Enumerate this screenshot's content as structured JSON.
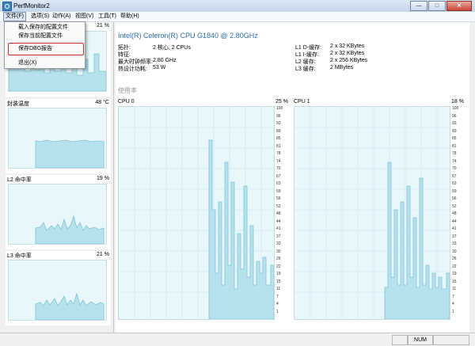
{
  "window": {
    "title": "PerfMonitor2",
    "min": "—",
    "max": "□",
    "close": "✕"
  },
  "menu": [
    "文件(F)",
    "选项(S)",
    "动作(A)",
    "视图(V)",
    "工具(T)",
    "帮助(H)"
  ],
  "file_menu": [
    "载入保存的配置文件",
    "保存当前配置文件",
    "保存DBG报告",
    "退出(X)"
  ],
  "left_panels": [
    {
      "title": "",
      "value": "21 %"
    },
    {
      "title": "封装温度",
      "value": "48 °C"
    },
    {
      "title": "L2 命中率",
      "value": "19 %"
    },
    {
      "title": "L3 命中率",
      "value": "21 %"
    }
  ],
  "cpu": {
    "name": "Intel(R) Celeron(R) CPU G1840 @ 2.80GHz",
    "specs_left": [
      {
        "label": "拓扑:",
        "value": "2 核心, 2 CPUs"
      },
      {
        "label": "特征:",
        "value": ""
      },
      {
        "label": "最大时钟频率:",
        "value": "2.80 GHz"
      },
      {
        "label": "热设计功耗:",
        "value": "53 W"
      }
    ],
    "specs_right": [
      {
        "label": "L1 D-缓存:",
        "value": "2 x 32 KBytes"
      },
      {
        "label": "L1 I-缓存:",
        "value": "2 x 32 KBytes"
      },
      {
        "label": "L2 缓存:",
        "value": "2 x 256 KBytes"
      },
      {
        "label": "L3 缓存:",
        "value": "2 MBytes"
      }
    ]
  },
  "usage_label": "使用率",
  "cpu_panels": [
    {
      "name": "CPU 0",
      "value": "25 %"
    },
    {
      "name": "CPU 1",
      "value": "18 %"
    }
  ],
  "scale_ticks": [
    "100",
    "96",
    "93",
    "89",
    "85",
    "81",
    "78",
    "74",
    "70",
    "67",
    "63",
    "59",
    "56",
    "52",
    "48",
    "44",
    "41",
    "37",
    "33",
    "30",
    "26",
    "22",
    "19",
    "15",
    "11",
    "7",
    "4",
    "1"
  ],
  "status": {
    "num": "NUM"
  },
  "colors": {
    "chart_fill": "#b6e2ee",
    "chart_bg": "#e8f7fb",
    "highlight": "#cc2b2b",
    "accent": "#2c6fb3"
  }
}
